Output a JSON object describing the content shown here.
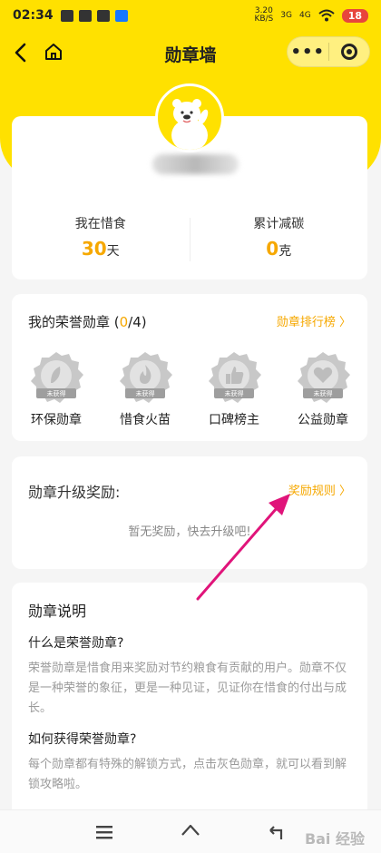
{
  "statusbar": {
    "time": "02:34",
    "speed": "3.20",
    "speed_unit": "KB/S",
    "net1": "3G",
    "net2": "4G",
    "battery": "18"
  },
  "navbar": {
    "title": "勋章墙"
  },
  "profile": {
    "stats": [
      {
        "label": "我在惜食",
        "value": "30",
        "unit": "天"
      },
      {
        "label": "累计减碳",
        "value": "0",
        "unit": "克"
      }
    ]
  },
  "badges": {
    "title_prefix": "我的荣誉勋章 (",
    "earned": "0",
    "title_suffix": "/4)",
    "rank_link": "勋章排行榜 〉",
    "items": [
      {
        "name": "环保勋章",
        "status": "未获得",
        "icon": "leaf-icon"
      },
      {
        "name": "惜食火苗",
        "status": "未获得",
        "icon": "flame-icon"
      },
      {
        "name": "口碑榜主",
        "status": "未获得",
        "icon": "thumbs-up-icon"
      },
      {
        "name": "公益勋章",
        "status": "未获得",
        "icon": "heart-hand-icon"
      }
    ]
  },
  "reward": {
    "title": "勋章升级奖励:",
    "rule_link": "奖励规则 〉",
    "empty": "暂无奖励，快去升级吧!"
  },
  "description": {
    "title": "勋章说明",
    "q1": "什么是荣誉勋章?",
    "a1": "荣誉勋章是惜食用来奖励对节约粮食有贡献的用户。勋章不仅是一种荣誉的象征，更是一种见证，见证你在惜食的付出与成长。",
    "q2": "如何获得荣誉勋章?",
    "a2": "每个勋章都有特殊的解锁方式，点击灰色勋章，就可以看到解锁攻略啦。"
  },
  "watermark": "Bai 经验",
  "colors": {
    "brand_yellow": "#ffe100",
    "accent_orange": "#f6a800",
    "annotation_arrow": "#e0147a"
  }
}
